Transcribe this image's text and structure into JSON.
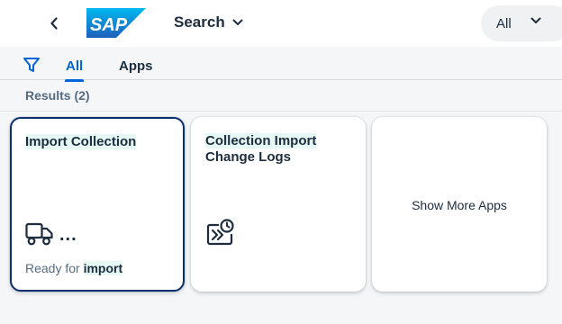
{
  "header": {
    "app_title": "Search",
    "scope": {
      "selected": "All"
    }
  },
  "tabs": [
    {
      "label": "All",
      "selected": true
    },
    {
      "label": "Apps",
      "selected": false
    }
  ],
  "results": {
    "title": "Results (2)"
  },
  "tiles": [
    {
      "title_highlight": "Import Collection",
      "title_rest": "",
      "icon": "truck-icon",
      "more": "...",
      "footer_text": "Ready for ",
      "footer_highlight": "import"
    },
    {
      "title_highlight": "Collection Import",
      "title_rest": "Change Logs",
      "icon": "import-history-icon"
    }
  ],
  "show_more": {
    "label": "Show More Apps"
  },
  "colors": {
    "accent": "#0064d9",
    "highlight": "#e6f8f4",
    "focus_border": "#0a2e6e",
    "sap_logo": "#0a6ed1"
  }
}
